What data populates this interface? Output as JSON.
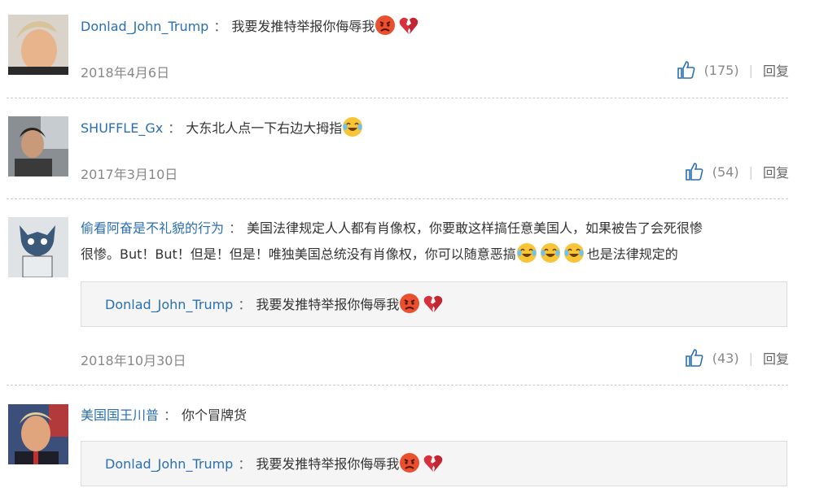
{
  "comments": [
    {
      "username": "Donlad_John_Trump",
      "text": "我要发推特举报你侮辱我",
      "date": "2018年4月6日",
      "likes": "(175)",
      "reply": "回复",
      "emojis": [
        "angry-face-icon",
        "broken-heart-icon"
      ]
    },
    {
      "username": "SHUFFLE_Gx",
      "text": "大东北人点一下右边大拇指",
      "date": "2017年3月10日",
      "likes": "(54)",
      "reply": "回复",
      "emojis": [
        "laughing-face-icon"
      ]
    },
    {
      "username": "偷看阿奋是不礼貌的行为",
      "text_line1": "美国法律规定人人都有肖像权，你要敢这样搞任意美国人，如果被告了会死很惨",
      "text_line2a": "很惨。But！But！但是！但是！唯独美国总统没有肖像权，你可以随意恶搞",
      "text_line2b": "也是法律规定的",
      "quote_username": "Donlad_John_Trump",
      "quote_text": "我要发推特举报你侮辱我",
      "date": "2018年10月30日",
      "likes": "(43)",
      "reply": "回复"
    },
    {
      "username": "美国国王川普",
      "text": "你个冒牌货",
      "quote_username": "Donlad_John_Trump",
      "quote_text": "我要发推特举报你侮辱我"
    }
  ],
  "colon": "："
}
